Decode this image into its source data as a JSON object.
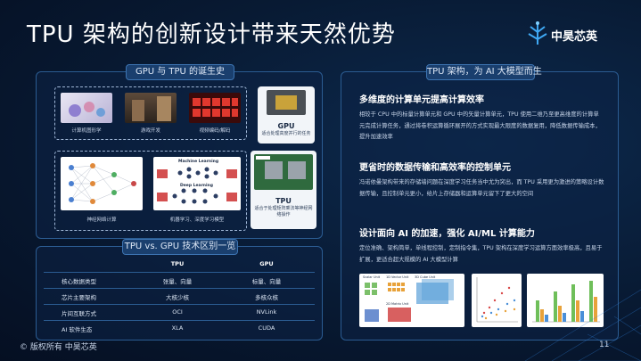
{
  "slide": {
    "title": "TPU 架构的创新设计带来天然优势",
    "logo_text": "中昊芯英",
    "footer": "© 版权所有 中昊芯英",
    "page_number": "11"
  },
  "history": {
    "header": "GPU 与 TPU 的诞生史",
    "top_items": [
      "计算机图形学",
      "游戏开发",
      "视频编码/解码"
    ],
    "bottom_items": [
      "神经网络计算",
      "机器学习、深度学习模型"
    ],
    "bottom_diagram_labels": [
      "Machine Learning",
      "Deep Learning"
    ],
    "gpu": {
      "name": "GPU",
      "desc": "适合处理高度并行的任务"
    },
    "tpu": {
      "name": "TPU",
      "desc": "适合于处理矩阵乘法等神经网络操作"
    }
  },
  "comparison": {
    "header": "TPU vs. GPU 技术区别一览",
    "columns": [
      "",
      "TPU",
      "GPU"
    ],
    "rows": [
      [
        "核心数据类型",
        "张量、向量",
        "标量、向量"
      ],
      [
        "芯片主要架构",
        "大核少核",
        "多核众核"
      ],
      [
        "片间互联方式",
        "OCI",
        "NVLink"
      ],
      [
        "AI 软件生态",
        "XLA",
        "CUDA"
      ]
    ]
  },
  "architecture": {
    "header": "TPU 架构，为 AI 大模型而生",
    "sections": [
      {
        "heading": "多维度的计算单元提高计算效率",
        "body": "相较于 CPU 中的标量计算单元和 GPU 中的矢量计算单元，TPU 使用二维乃至更高维度的计算单元完成计算任务，通过将卷积运算循环展开的方式实现最大限度的数据复用，降低数据传输成本，提升加速效率"
      },
      {
        "heading": "更省时的数据传输和高效率的控制单元",
        "body": "冯诺依曼架构带来的存储墙问题在深度学习任务当中尤为突出，而 TPU 采用更为激进的策略设计数据传输，且控制单元更小，给片上存储器和运算单元留下了更大的空间"
      },
      {
        "heading": "设计面向 AI 的加速，强化 AI/ML 计算能力",
        "body": "定位准确、架构简单，单线程控制，定制指令集，TPU 架构在深度学习运算方面效率极高，且易于扩展，更适合超大规模的 AI 大模型计算"
      }
    ],
    "figure_labels": [
      "Scalar Unit",
      "1D Vector Unit",
      "2D Matrix Unit",
      "3D Cube Unit"
    ]
  }
}
